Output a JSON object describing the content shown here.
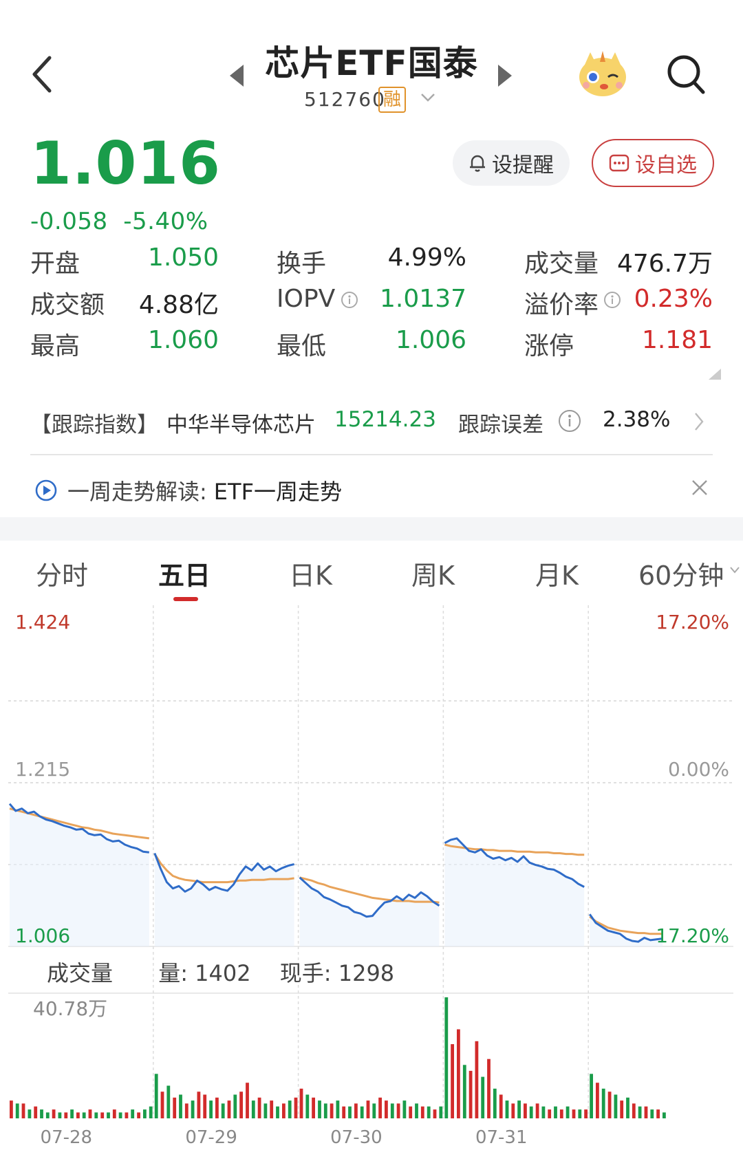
{
  "header": {
    "title": "芯片ETF国泰",
    "code": "512760",
    "margin_badge": "融"
  },
  "quote": {
    "price": "1.016",
    "change": "-0.058",
    "change_pct": "-5.40%",
    "remind_label": "设提醒",
    "watch_label": "设自选"
  },
  "stats": [
    {
      "label": "开盘",
      "value": "1.050",
      "color": "green"
    },
    {
      "label": "换手",
      "value": "4.99%",
      "color": "black"
    },
    {
      "label": "成交量",
      "value": "476.7万",
      "color": "black"
    },
    {
      "label": "成交额",
      "value": "4.88亿",
      "color": "black"
    },
    {
      "label": "IOPV",
      "value": "1.0137",
      "color": "green",
      "info": true
    },
    {
      "label": "溢价率",
      "value": "0.23%",
      "color": "red",
      "info": true
    },
    {
      "label": "最高",
      "value": "1.060",
      "color": "green"
    },
    {
      "label": "最低",
      "value": "1.006",
      "color": "green"
    },
    {
      "label": "涨停",
      "value": "1.181",
      "color": "red"
    }
  ],
  "tracking": {
    "tag": "【跟踪指数】",
    "index_name": "中华半导体芯片",
    "index_value": "15214.23",
    "error_label": "跟踪误差",
    "error_value": "2.38%"
  },
  "weekly": {
    "prefix": "一周走势解读:",
    "text": "ETF一周走势"
  },
  "tabs": [
    "分时",
    "五日",
    "日K",
    "周K",
    "月K",
    "60分钟"
  ],
  "active_tab": 1,
  "colors": {
    "up": "#d22b2b",
    "down": "#1a9c4a",
    "price_line": "#2f6cc8",
    "avg_line": "#e8a35a"
  },
  "chart_data": {
    "type": "line",
    "price_axis": {
      "top": "1.424",
      "mid": "1.215",
      "bottom": "1.006"
    },
    "pct_axis": {
      "top": "17.20%",
      "mid": "0.00%",
      "bottom": "17.20%"
    },
    "ylim": [
      1.006,
      1.424
    ],
    "dates": [
      "07-28",
      "07-29",
      "07-30",
      "07-31"
    ],
    "series": [
      {
        "key": "price",
        "days": [
          [
            1.188,
            1.179,
            1.182,
            1.176,
            1.178,
            1.172,
            1.168,
            1.166,
            1.163,
            1.16,
            1.158,
            1.155,
            1.156,
            1.15,
            1.148,
            1.149,
            1.143,
            1.14,
            1.141,
            1.136,
            1.133,
            1.131,
            1.127,
            1.126
          ],
          [
            1.125,
            1.105,
            1.088,
            1.08,
            1.083,
            1.076,
            1.08,
            1.09,
            1.085,
            1.078,
            1.082,
            1.079,
            1.077,
            1.085,
            1.098,
            1.108,
            1.103,
            1.112,
            1.104,
            1.108,
            1.102,
            1.106,
            1.109,
            1.111
          ],
          [
            1.094,
            1.087,
            1.08,
            1.076,
            1.069,
            1.066,
            1.062,
            1.058,
            1.056,
            1.05,
            1.048,
            1.044,
            1.045,
            1.054,
            1.062,
            1.064,
            1.07,
            1.065,
            1.072,
            1.068,
            1.075,
            1.07,
            1.063,
            1.058
          ],
          [
            1.138,
            1.142,
            1.144,
            1.136,
            1.128,
            1.126,
            1.13,
            1.122,
            1.118,
            1.12,
            1.116,
            1.119,
            1.114,
            1.121,
            1.113,
            1.11,
            1.108,
            1.105,
            1.104,
            1.1,
            1.095,
            1.092,
            1.086,
            1.082
          ],
          [
            1.047,
            1.036,
            1.031,
            1.026,
            1.024,
            1.022,
            1.016,
            1.013,
            1.012,
            1.017,
            1.014,
            1.015,
            1.016
          ]
        ]
      },
      {
        "key": "average",
        "days": [
          [
            1.182,
            1.18,
            1.178,
            1.176,
            1.174,
            1.172,
            1.17,
            1.168,
            1.166,
            1.164,
            1.162,
            1.16,
            1.158,
            1.157,
            1.155,
            1.154,
            1.152,
            1.15,
            1.149,
            1.148,
            1.147,
            1.146,
            1.145,
            1.144
          ],
          [
            1.124,
            1.112,
            1.103,
            1.096,
            1.093,
            1.091,
            1.09,
            1.089,
            1.088,
            1.088,
            1.088,
            1.088,
            1.088,
            1.089,
            1.09,
            1.09,
            1.091,
            1.091,
            1.091,
            1.092,
            1.092,
            1.092,
            1.092,
            1.093
          ],
          [
            1.094,
            1.092,
            1.09,
            1.087,
            1.085,
            1.082,
            1.08,
            1.078,
            1.076,
            1.074,
            1.072,
            1.07,
            1.068,
            1.067,
            1.066,
            1.065,
            1.064,
            1.064,
            1.064,
            1.063,
            1.063,
            1.063,
            1.063,
            1.062
          ],
          [
            1.136,
            1.134,
            1.133,
            1.132,
            1.131,
            1.13,
            1.13,
            1.129,
            1.129,
            1.128,
            1.128,
            1.128,
            1.127,
            1.127,
            1.127,
            1.126,
            1.126,
            1.126,
            1.125,
            1.125,
            1.124,
            1.124,
            1.123,
            1.123
          ],
          [
            1.044,
            1.038,
            1.034,
            1.03,
            1.028,
            1.026,
            1.025,
            1.024,
            1.023,
            1.023,
            1.022,
            1.022,
            1.022
          ]
        ]
      }
    ],
    "volume": {
      "title": "成交量",
      "amount_label": "量: 1402",
      "hand_label": "现手: 1298",
      "max_label": "40.78万",
      "max": 40.78,
      "bars": [
        [
          6,
          5,
          5,
          3,
          4,
          3,
          2,
          3,
          2,
          2,
          3,
          2,
          2,
          3,
          2,
          2,
          2,
          3,
          2,
          2,
          3,
          2,
          3,
          4
        ],
        [
          15,
          9,
          11,
          7,
          8,
          5,
          6,
          9,
          8,
          6,
          7,
          5,
          6,
          8,
          9,
          12,
          6,
          7,
          5,
          6,
          4,
          5,
          6,
          7
        ],
        [
          10,
          8,
          7,
          6,
          5,
          5,
          6,
          4,
          4,
          5,
          4,
          6,
          5,
          7,
          6,
          5,
          5,
          6,
          4,
          5,
          4,
          4,
          3,
          4
        ],
        [
          40.78,
          25,
          30,
          18,
          16,
          26,
          14,
          20,
          10,
          8,
          6,
          5,
          6,
          5,
          4,
          5,
          4,
          3,
          4,
          3,
          4,
          3,
          3,
          3
        ],
        [
          15,
          12,
          10,
          9,
          8,
          6,
          7,
          5,
          4,
          4,
          3,
          3,
          2
        ]
      ],
      "bar_colors": [
        [
          "r",
          "g",
          "r",
          "g",
          "r",
          "g",
          "g",
          "r",
          "g",
          "r",
          "g",
          "r",
          "g",
          "r",
          "g",
          "r",
          "g",
          "r",
          "g",
          "r",
          "g",
          "r",
          "g",
          "g"
        ],
        [
          "g",
          "r",
          "g",
          "r",
          "g",
          "r",
          "g",
          "r",
          "r",
          "g",
          "r",
          "g",
          "r",
          "g",
          "r",
          "r",
          "g",
          "r",
          "g",
          "r",
          "g",
          "r",
          "g",
          "r"
        ],
        [
          "r",
          "g",
          "r",
          "g",
          "g",
          "r",
          "g",
          "r",
          "g",
          "r",
          "g",
          "r",
          "g",
          "r",
          "r",
          "g",
          "r",
          "g",
          "r",
          "g",
          "r",
          "g",
          "r",
          "g"
        ],
        [
          "g",
          "r",
          "r",
          "g",
          "r",
          "r",
          "g",
          "r",
          "g",
          "r",
          "g",
          "r",
          "g",
          "r",
          "g",
          "r",
          "g",
          "r",
          "g",
          "r",
          "g",
          "r",
          "g",
          "r"
        ],
        [
          "g",
          "r",
          "g",
          "r",
          "g",
          "r",
          "g",
          "r",
          "g",
          "r",
          "g",
          "r",
          "g"
        ]
      ]
    }
  }
}
